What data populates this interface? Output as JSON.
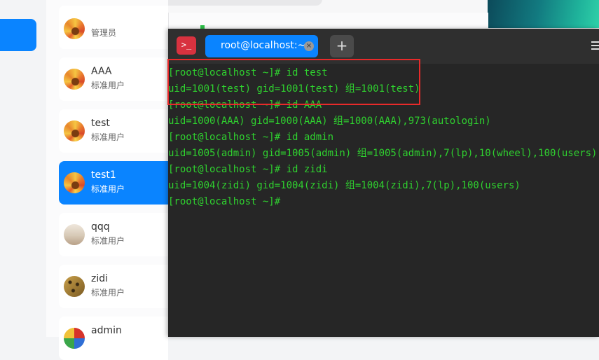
{
  "users": [
    {
      "name": "",
      "role": "管理员",
      "avatar": "flower-avatar"
    },
    {
      "name": "AAA",
      "role": "标准用户",
      "avatar": "flower-avatar"
    },
    {
      "name": "test",
      "role": "标准用户",
      "avatar": "flower-avatar"
    },
    {
      "name": "test1",
      "role": "标准用户",
      "avatar": "flower-avatar",
      "selected": true
    },
    {
      "name": "qqq",
      "role": "标准用户",
      "avatar": "room-avatar"
    },
    {
      "name": "zidi",
      "role": "标准用户",
      "avatar": "leopard-avatar"
    },
    {
      "name": "admin",
      "role": "",
      "avatar": "bird-avatar"
    }
  ],
  "terminal": {
    "icon": "terminal-icon",
    "tab_title": "root@localhost:~",
    "close_glyph": "×",
    "add_glyph": "+",
    "lines": [
      "[root@localhost ~]# id test",
      "uid=1001(test) gid=1001(test) 组=1001(test)",
      "[root@localhost ~]# id AAA",
      "uid=1000(AAA) gid=1000(AAA) 组=1000(AAA),973(autologin)",
      "[root@localhost ~]# id admin",
      "uid=1005(admin) gid=1005(admin) 组=1005(admin),7(lp),10(wheel),100(users)",
      "[root@localhost ~]# id zidi",
      "uid=1004(zidi) gid=1004(zidi) 组=1004(zidi),7(lp),100(users)",
      "[root@localhost ~]#"
    ],
    "text_color": "#2fd12f",
    "highlight_color": "#e82a2a"
  },
  "colors": {
    "accent": "#0a84ff",
    "terminal_bg": "#262626"
  }
}
